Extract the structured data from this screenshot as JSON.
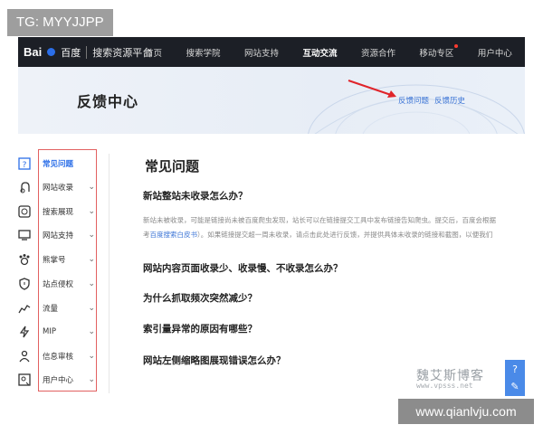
{
  "overlay_tag": "TG: MYYJJPP",
  "topnav": {
    "logo_text": "Bai",
    "logo_du": "百度",
    "platform_name": "搜索资源平台",
    "items": [
      {
        "label": "首页",
        "active": false
      },
      {
        "label": "搜索学院",
        "active": false
      },
      {
        "label": "网站支持",
        "active": false
      },
      {
        "label": "互动交流",
        "active": true
      },
      {
        "label": "资源合作",
        "active": false
      },
      {
        "label": "移动专区",
        "active": false,
        "dot": true
      },
      {
        "label": "用户中心",
        "active": false
      }
    ]
  },
  "banner": {
    "title": "反馈中心",
    "links": [
      "反馈问题",
      "反馈历史"
    ]
  },
  "sidebar": {
    "items": [
      {
        "label": "常见问题",
        "icon": "faq-icon",
        "active": true,
        "chevron": false
      },
      {
        "label": "网站收录",
        "icon": "index-icon",
        "chevron": true
      },
      {
        "label": "搜索展现",
        "icon": "search-display-icon",
        "chevron": true
      },
      {
        "label": "网站支持",
        "icon": "site-support-icon",
        "chevron": true
      },
      {
        "label": "熊掌号",
        "icon": "bear-paw-icon",
        "chevron": true
      },
      {
        "label": "站点侵权",
        "icon": "shield-icon",
        "chevron": true
      },
      {
        "label": "流量",
        "icon": "traffic-chart-icon",
        "chevron": true
      },
      {
        "label": "MIP",
        "icon": "lightning-icon",
        "chevron": true
      },
      {
        "label": "信息审核",
        "icon": "person-review-icon",
        "chevron": true
      },
      {
        "label": "用户中心",
        "icon": "user-card-icon",
        "chevron": true
      }
    ]
  },
  "main": {
    "heading": "常见问题",
    "q1": "新站整站未收录怎么办？",
    "a1_line1": "新站未被收录，可能是链接尚未被百度爬虫发现，站长可以在链接提交工具中发布链接告知爬虫。提交后，百度会根据",
    "a1_line2_prefix": "考",
    "a1_line2_link": "百度搜索白皮书",
    "a1_line2_suffix": "）。如果链接提交超一周未收录，请点击此处进行反馈，并提供具体未收录的链接和截图，以便我们",
    "q2": "网站内容页面收录少、收录慢、不收录怎么办？",
    "q3": "为什么抓取频次突然减少？",
    "q4": "索引量异常的原因有哪些？",
    "q5": "网站左侧缩略图展现错误怎么办？"
  },
  "floating": {
    "help_glyph": "?",
    "edit_glyph": "✎"
  },
  "watermarks": {
    "site_cn": "魏艾斯博客",
    "site_en": "www.vpsss.net",
    "bottom_url": "www.qianlvju.com"
  }
}
